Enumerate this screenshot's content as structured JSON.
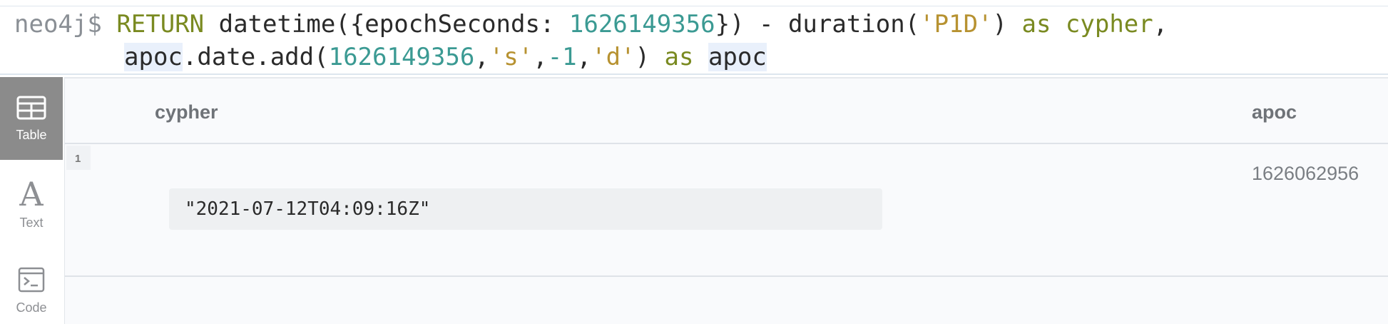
{
  "editor": {
    "prompt": "neo4j$",
    "line1": [
      {
        "t": "RETURN",
        "c": "kw"
      },
      {
        "t": " datetime({epochSeconds: ",
        "c": ""
      },
      {
        "t": "1626149356",
        "c": "num"
      },
      {
        "t": "}) - duration(",
        "c": ""
      },
      {
        "t": "'P1D'",
        "c": "str"
      },
      {
        "t": ") ",
        "c": ""
      },
      {
        "t": "as",
        "c": "kw"
      },
      {
        "t": " ",
        "c": ""
      },
      {
        "t": "cypher",
        "c": "kw"
      },
      {
        "t": ",",
        "c": ""
      }
    ],
    "line2": [
      {
        "t": "apoc",
        "c": "hl"
      },
      {
        "t": ".date.add(",
        "c": ""
      },
      {
        "t": "1626149356",
        "c": "num"
      },
      {
        "t": ",",
        "c": ""
      },
      {
        "t": "'s'",
        "c": "str"
      },
      {
        "t": ",",
        "c": ""
      },
      {
        "t": "-1",
        "c": "num"
      },
      {
        "t": ",",
        "c": ""
      },
      {
        "t": "'d'",
        "c": "str"
      },
      {
        "t": ") ",
        "c": ""
      },
      {
        "t": "as",
        "c": "kw"
      },
      {
        "t": " ",
        "c": ""
      },
      {
        "t": "apoc",
        "c": "hl"
      }
    ]
  },
  "sidebar": {
    "table_label": "Table",
    "text_label": "Text",
    "text_glyph": "A",
    "code_label": "Code"
  },
  "table": {
    "headers": [
      "cypher",
      "apoc"
    ],
    "rows": [
      {
        "num": "1",
        "cypher": "\"2021-07-12T04:09:16Z\"",
        "apoc": "1626062956"
      }
    ]
  }
}
